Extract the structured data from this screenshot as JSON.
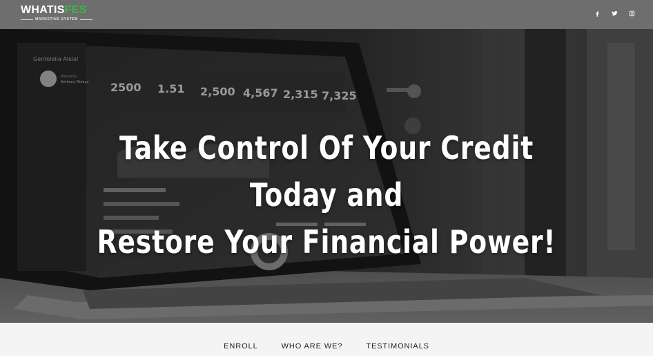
{
  "brand": {
    "logo_part1": "WHATIS",
    "logo_part2": "FES",
    "tagline": "MARKETING SYSTEM",
    "accent_color": "#3bb54a"
  },
  "social": [
    {
      "name": "facebook",
      "icon": "facebook-icon"
    },
    {
      "name": "twitter",
      "icon": "twitter-icon"
    },
    {
      "name": "instagram",
      "icon": "instagram-icon"
    }
  ],
  "hero": {
    "headline_line1": "Take Control Of Your Credit Today and",
    "headline_line2": "Restore Your Financial Power!",
    "dashboard": {
      "sidebar_title": "Gentelella Alela!",
      "user_welcome": "Welcome,",
      "user_name": "Anthony Mulaya",
      "stats": [
        "2500",
        "1.51",
        "2,500",
        "4,567",
        "2,315",
        "7,325"
      ]
    }
  },
  "nav": {
    "items": [
      "ENROLL",
      "WHO ARE WE?",
      "TESTIMONIALS"
    ]
  }
}
